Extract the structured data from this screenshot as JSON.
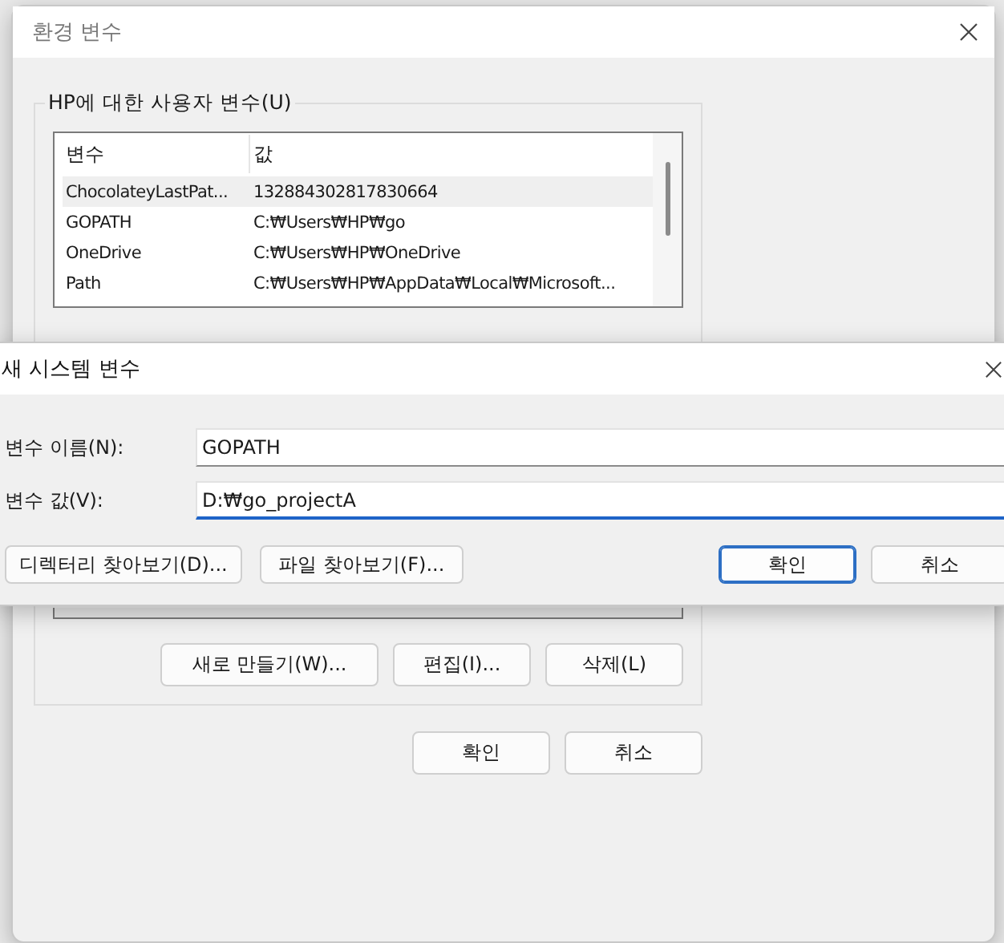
{
  "environment_dialog": {
    "title": "환경 변수",
    "user_variables": {
      "label": "HP에 대한 사용자 변수(U)",
      "columns": [
        "변수",
        "값"
      ],
      "rows": [
        {
          "name": "ChocolateyLastPat...",
          "value": "132884302817830664",
          "selected": true
        },
        {
          "name": "GOPATH",
          "value": "C:₩Users₩HP₩go",
          "selected": false
        },
        {
          "name": "OneDrive",
          "value": "C:₩Users₩HP₩OneDrive",
          "selected": false
        },
        {
          "name": "Path",
          "value": "C:₩Users₩HP₩AppData₩Local₩Microsoft...",
          "selected": false
        }
      ]
    },
    "list_buttons": [
      "새로 만들기(W)...",
      "편집(I)...",
      "삭제(L)"
    ],
    "footer_buttons": [
      {
        "label": "확인",
        "primary": false
      },
      {
        "label": "취소",
        "primary": false
      }
    ]
  },
  "new_variable_dialog": {
    "title": "새 시스템 변수",
    "fields": [
      {
        "label": "변수 이름(N):",
        "value": "GOPATH",
        "focused": false
      },
      {
        "label": "변수 값(V):",
        "value": "D:₩go_projectA",
        "focused": true
      }
    ],
    "left_buttons": [
      "디렉터리 찾아보기(D)...",
      "파일 찾아보기(F)..."
    ],
    "right_buttons": [
      {
        "label": "확인",
        "primary": true
      },
      {
        "label": "취소",
        "primary": false
      }
    ]
  }
}
